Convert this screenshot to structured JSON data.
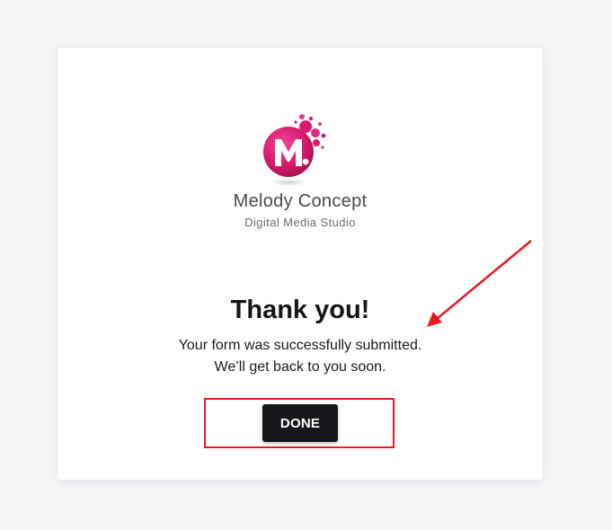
{
  "brand": {
    "name": "Melody Concept",
    "tagline": "Digital Media Studio",
    "logo_letter": "M",
    "accent_color": "#d81b6e",
    "icon": "melody-concept-logo-icon"
  },
  "confirmation": {
    "title": "Thank you!",
    "line1": "Your form was successfully submitted.",
    "line2": "We’ll get back to you soon."
  },
  "actions": {
    "done_label": "DONE"
  },
  "annotations": {
    "highlight_color": "#e8191f",
    "arrow_icon": "red-arrow-icon"
  }
}
